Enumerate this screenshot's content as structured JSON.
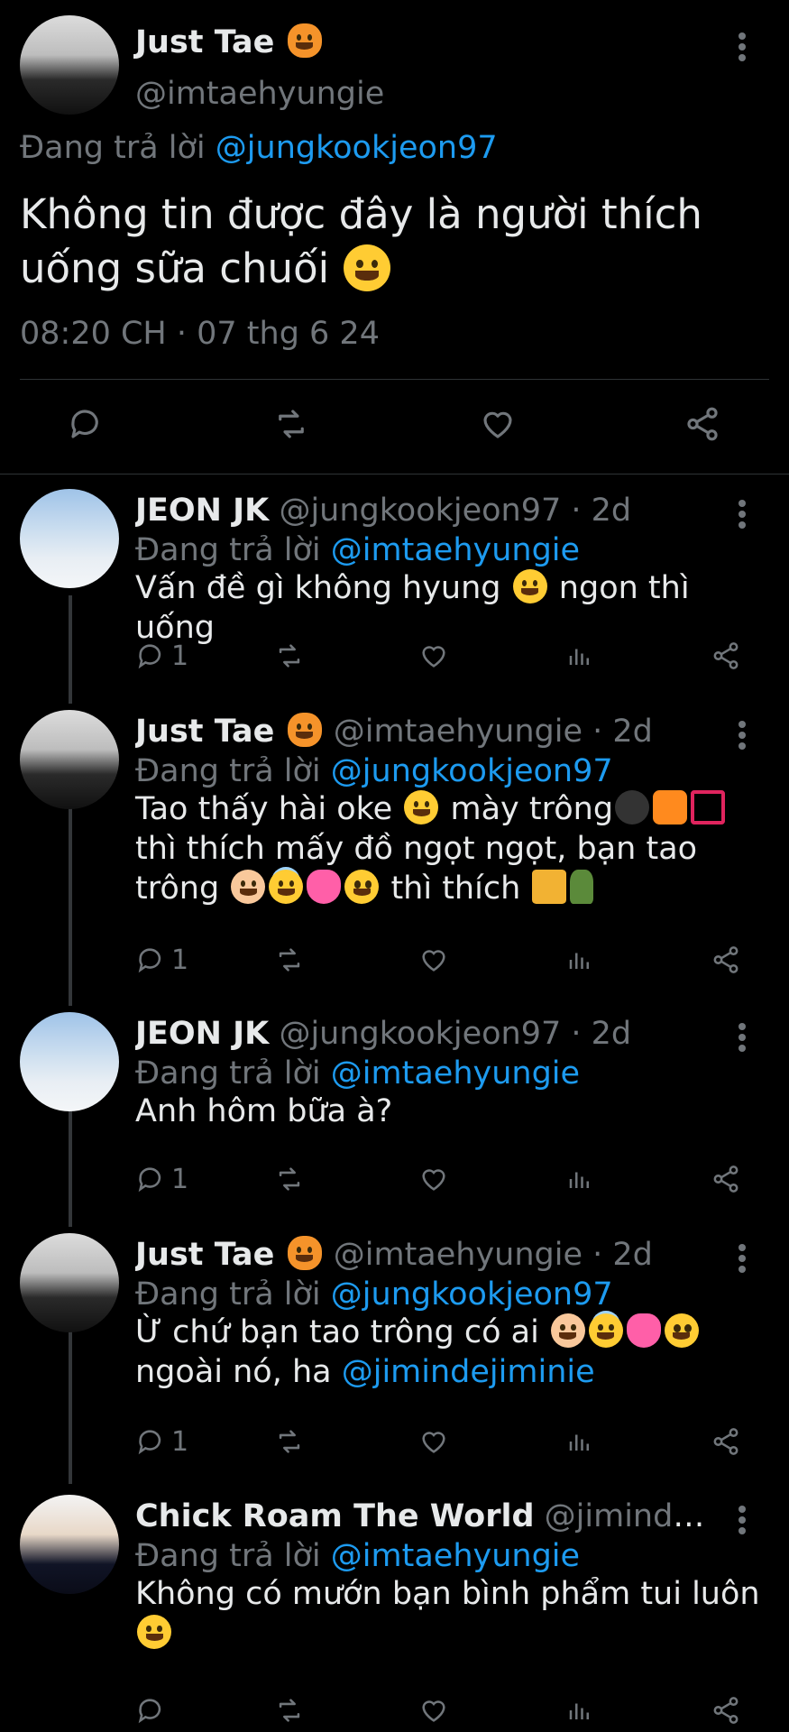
{
  "main_tweet": {
    "name": "Just Tae",
    "handle": "@imtaehyungie",
    "reply_prefix": "Đang trả lời",
    "reply_to": "@jungkookjeon97",
    "text": "Không tin được đây là người thích uống sữa chuối",
    "time": "08:20 CH · 07 thg 6 24"
  },
  "replies": [
    {
      "name": "JEON JK",
      "handle": "@jungkookjeon97 · 2d",
      "reply_prefix": "Đang trả lời",
      "reply_to": "@imtaehyungie",
      "text_a": "Vấn đề gì không hyung",
      "text_b": "ngon thì uống",
      "replies_count": "1"
    },
    {
      "name": "Just Tae",
      "handle": "@imtaehyungie · 2d",
      "reply_prefix": "Đang trả lời",
      "reply_to": "@jungkookjeon97",
      "text_a": "Tao thấy hài oke",
      "text_b": "mày trông",
      "text_c": "thì thích mấy đồ ngọt ngọt, bạn tao trông",
      "text_d": "thì thích",
      "replies_count": "1"
    },
    {
      "name": "JEON JK",
      "handle": "@jungkookjeon97 · 2d",
      "reply_prefix": "Đang trả lời",
      "reply_to": "@imtaehyungie",
      "text_a": "Anh hôm bữa à?",
      "replies_count": "1"
    },
    {
      "name": "Just Tae",
      "handle": "@imtaehyungie · 2d",
      "reply_prefix": "Đang trả lời",
      "reply_to": "@jungkookjeon97",
      "text_a": "Ừ chứ bạn tao trông có ai",
      "text_b": "ngoài nó, ha",
      "mention": "@jimindejiminie",
      "replies_count": "1"
    },
    {
      "name": "Chick Roam The World",
      "handle": "@jimindejim...",
      "reply_prefix": "Đang trả lời",
      "reply_to": "@imtaehyungie",
      "text_a": "Không có mướn bạn bình phẩm tui luôn"
    }
  ],
  "icons": {
    "reply": "reply-icon",
    "retweet": "retweet-icon",
    "like": "like-icon",
    "share": "share-icon",
    "views": "views-icon",
    "more": "more-icon"
  },
  "colors": {
    "background": "#000000",
    "text": "#e7e9ea",
    "muted": "#71767b",
    "link": "#1d9bf0",
    "divider": "#2f3336"
  }
}
